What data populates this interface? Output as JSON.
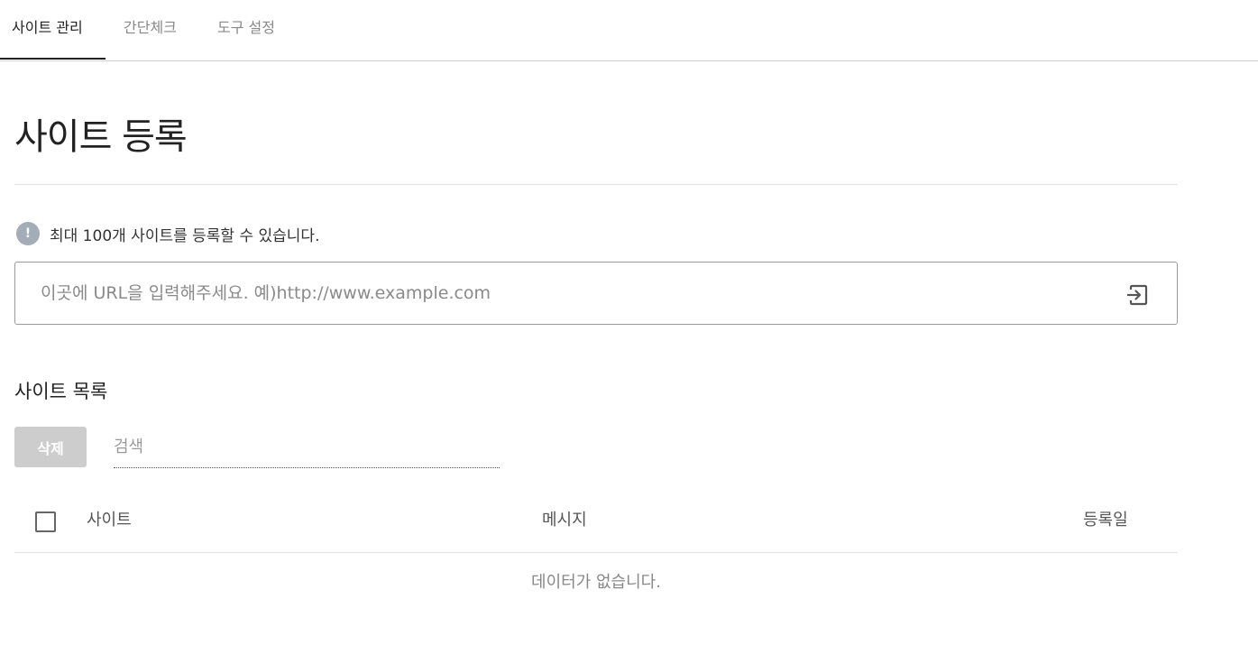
{
  "tabs": [
    {
      "label": "사이트 관리",
      "active": true
    },
    {
      "label": "간단체크",
      "active": false
    },
    {
      "label": "도구 설정",
      "active": false
    }
  ],
  "page": {
    "title": "사이트 등록",
    "notice_icon": "exclamation-icon",
    "notice": "최대 100개 사이트를 등록할 수 있습니다."
  },
  "url_input": {
    "value": "",
    "placeholder": "이곳에 URL을 입력해주세요. 예)http://www.example.com",
    "submit_icon": "enter-icon"
  },
  "site_list": {
    "title": "사이트 목록",
    "delete_label": "삭제",
    "search_placeholder": "검색",
    "columns": [
      "사이트",
      "메시지",
      "등록일"
    ],
    "rows": [],
    "empty_message": "데이터가 없습니다."
  },
  "colors": {
    "accent": "#222222",
    "notice_icon_bg": "#a3adb7",
    "disabled_button": "#cdcdcd"
  }
}
